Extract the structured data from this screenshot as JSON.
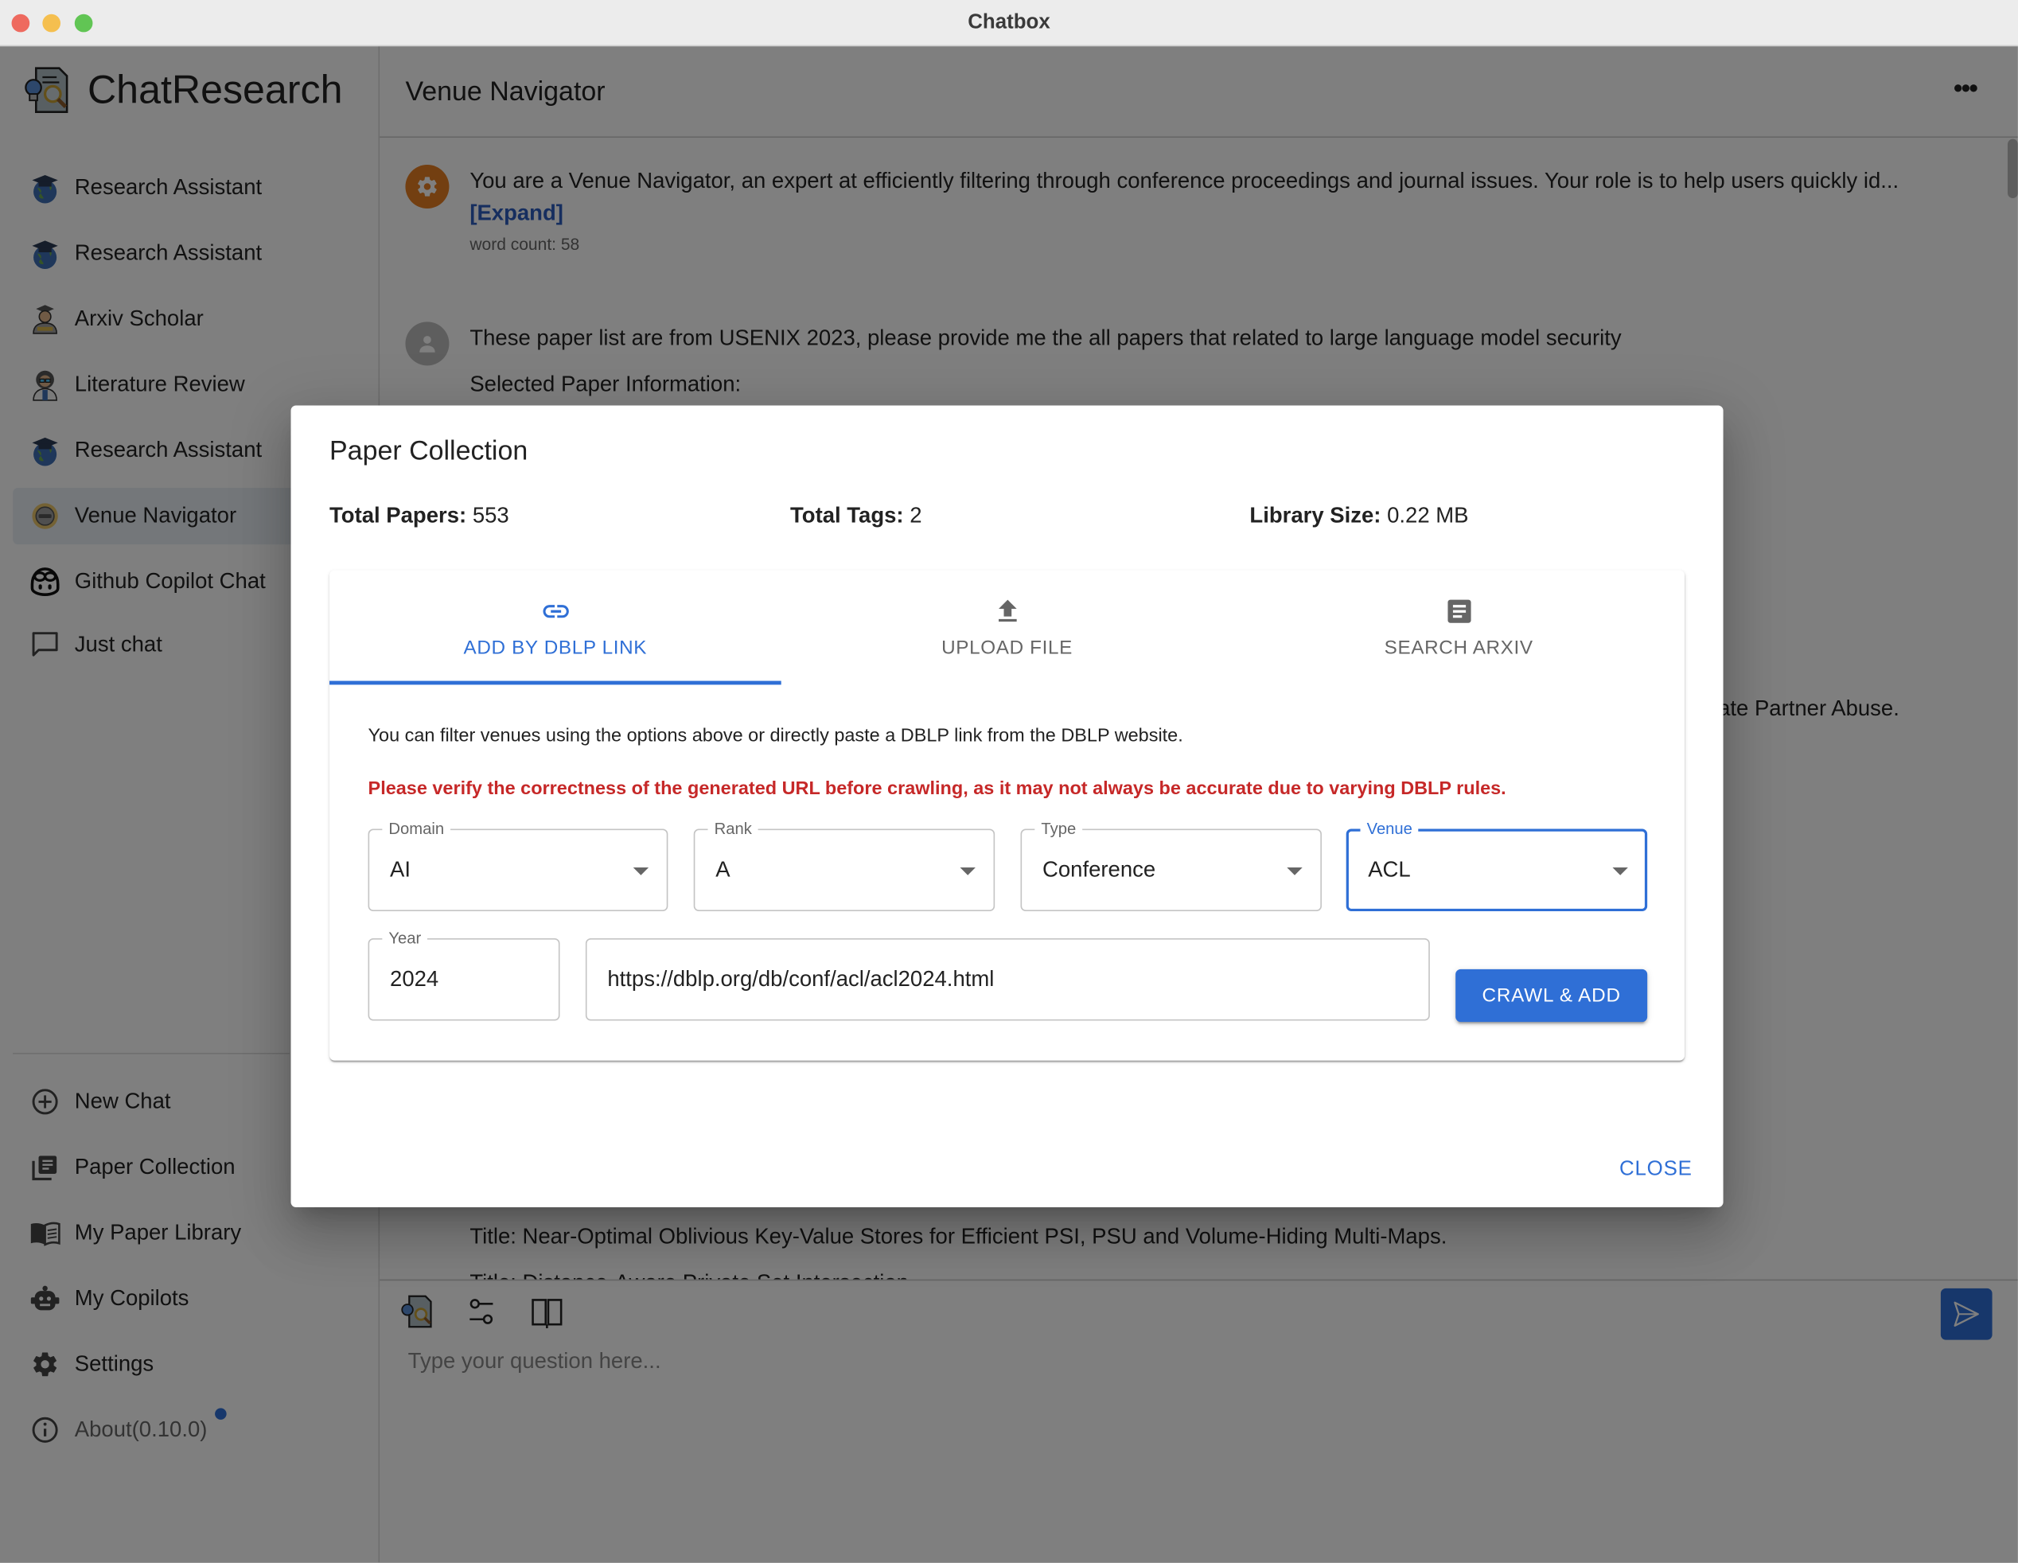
{
  "window": {
    "title": "Chatbox"
  },
  "brand": {
    "name": "ChatResearch",
    "logo_icon": "research-logo-icon"
  },
  "sidebar": {
    "copilots": [
      {
        "label": "Research Assistant",
        "icon": "graduation-globe-icon",
        "active": false
      },
      {
        "label": "Research Assistant",
        "icon": "graduation-globe-icon",
        "active": false
      },
      {
        "label": "Arxiv Scholar",
        "icon": "scholar-icon",
        "active": false
      },
      {
        "label": "Literature Review",
        "icon": "scientist-icon",
        "active": false
      },
      {
        "label": "Research Assistant",
        "icon": "graduation-globe-icon",
        "active": false
      },
      {
        "label": "Venue Navigator",
        "icon": "compass-icon",
        "active": true
      },
      {
        "label": "Github Copilot Chat",
        "icon": "copilot-icon",
        "active": false
      },
      {
        "label": "Just chat",
        "icon": "chat-bubble-icon",
        "active": false
      }
    ],
    "actions": [
      {
        "label": "New Chat",
        "icon": "plus-circle-icon"
      },
      {
        "label": "Paper Collection",
        "icon": "collection-icon"
      },
      {
        "label": "My Paper Library",
        "icon": "book-icon"
      },
      {
        "label": "My Copilots",
        "icon": "robot-icon"
      },
      {
        "label": "Settings",
        "icon": "gear-icon"
      },
      {
        "label": "About(0.10.0)",
        "icon": "info-icon",
        "has_update_dot": true
      }
    ]
  },
  "main": {
    "title": "Venue Navigator",
    "more_icon": "more-horizontal-icon",
    "messages": [
      {
        "role": "system",
        "text": "You are a Venue Navigator, an expert at efficiently filtering through conference proceedings and journal issues. Your role is to help users quickly id...",
        "expand_label": "[Expand]",
        "word_count": "word count: 58"
      },
      {
        "role": "user",
        "text": "These paper list are from USENIX 2023, please provide me the all papers that related to large language model security",
        "subtext": "Selected Paper Information:"
      }
    ],
    "partial_right_text": "ate Partner Abuse.",
    "partial_bottom_text": "Title: Near-Optimal Oblivious Key-Value Stores for Efficient PSI, PSU and Volume-Hiding Multi-Maps.",
    "partial_cut_text": "Title: Distance-Aware Private Set Intersection."
  },
  "composer": {
    "placeholder": "Type your question here...",
    "tools": [
      "research-logo-icon",
      "sliders-icon",
      "book-open-icon"
    ],
    "send_icon": "send-icon"
  },
  "modal": {
    "title": "Paper Collection",
    "stats": [
      {
        "label": "Total Papers:",
        "value": "553"
      },
      {
        "label": "Total Tags:",
        "value": "2"
      },
      {
        "label": "Library Size:",
        "value": "0.22 MB"
      }
    ],
    "tabs": [
      {
        "label": "ADD BY DBLP LINK",
        "icon": "link-icon",
        "active": true
      },
      {
        "label": "UPLOAD FILE",
        "icon": "upload-icon",
        "active": false
      },
      {
        "label": "SEARCH ARXIV",
        "icon": "article-icon",
        "active": false
      }
    ],
    "hint": "You can filter venues using the options above or directly paste a DBLP link from the DBLP website.",
    "warning": "Please verify the correctness of the generated URL before crawling, as it may not always be accurate due to varying DBLP rules.",
    "fields": {
      "domain": {
        "label": "Domain",
        "value": "AI"
      },
      "rank": {
        "label": "Rank",
        "value": "A"
      },
      "type": {
        "label": "Type",
        "value": "Conference"
      },
      "venue": {
        "label": "Venue",
        "value": "ACL"
      },
      "year": {
        "label": "Year",
        "value": "2024"
      },
      "url": {
        "value": "https://dblp.org/db/conf/acl/acl2024.html"
      }
    },
    "crawl_button": "CRAWL & ADD",
    "close_button": "CLOSE"
  },
  "colors": {
    "accent": "#2f6fd6",
    "warning": "#c62828",
    "overlay": "rgba(0,0,0,0.5)"
  }
}
